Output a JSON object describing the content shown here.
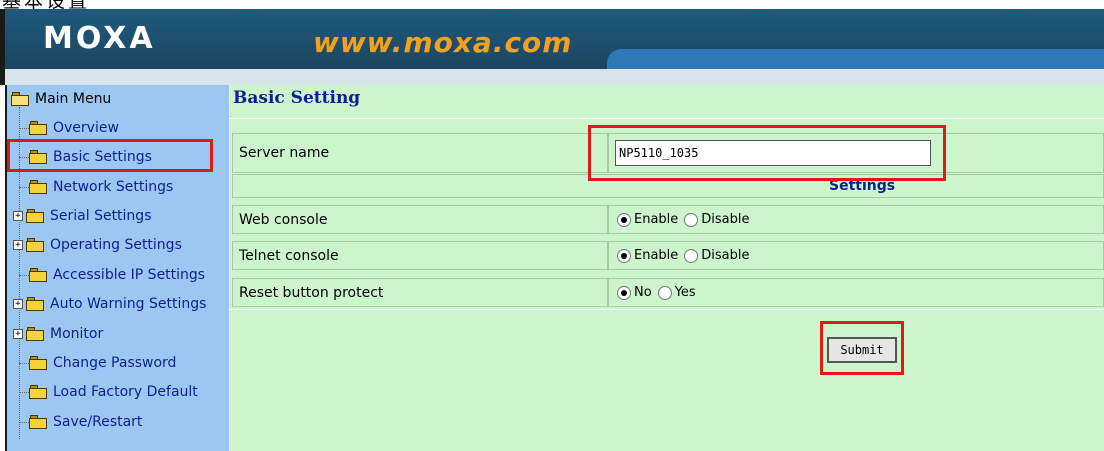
{
  "header": {
    "logo": "MOXA",
    "site_url": "www.moxa.com"
  },
  "sidebar": {
    "root_label": "Main Menu",
    "items": [
      {
        "label": "Overview",
        "expandable": false
      },
      {
        "label": "Basic Settings",
        "expandable": false,
        "selected": true
      },
      {
        "label": "Network Settings",
        "expandable": false
      },
      {
        "label": "Serial Settings",
        "expandable": true
      },
      {
        "label": "Operating Settings",
        "expandable": true
      },
      {
        "label": "Accessible IP Settings",
        "expandable": false
      },
      {
        "label": "Auto Warning Settings",
        "expandable": true
      },
      {
        "label": "Monitor",
        "expandable": true
      },
      {
        "label": "Change Password",
        "expandable": false
      },
      {
        "label": "Load Factory Default",
        "expandable": false
      },
      {
        "label": "Save/Restart",
        "expandable": false
      }
    ]
  },
  "main": {
    "page_title": "Basic Setting",
    "server_name": {
      "label": "Server name",
      "value": "NP5110_1035"
    },
    "section_header": "Settings",
    "web_console": {
      "label": "Web console",
      "option_enable": "Enable",
      "option_disable": "Disable",
      "selected": "Enable"
    },
    "telnet_console": {
      "label": "Telnet console",
      "option_enable": "Enable",
      "option_disable": "Disable",
      "selected": "Enable"
    },
    "reset_button": {
      "label": "Reset button protect",
      "option_no": "No",
      "option_yes": "Yes",
      "selected": "No"
    },
    "submit_label": "Submit"
  },
  "colors": {
    "highlight": "#e01818",
    "sidebar_bg": "#9cc7f2",
    "content_bg": "#ccf5cc",
    "link_text": "#0d1f90",
    "header_accent": "#f2a020"
  }
}
